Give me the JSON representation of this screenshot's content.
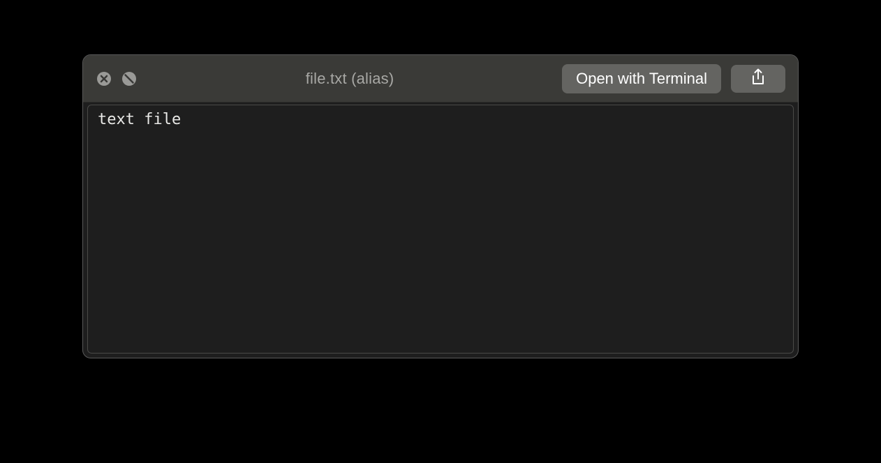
{
  "titlebar": {
    "title": "file.txt (alias)",
    "open_button_label": "Open with Terminal"
  },
  "content": {
    "text": "text file"
  }
}
